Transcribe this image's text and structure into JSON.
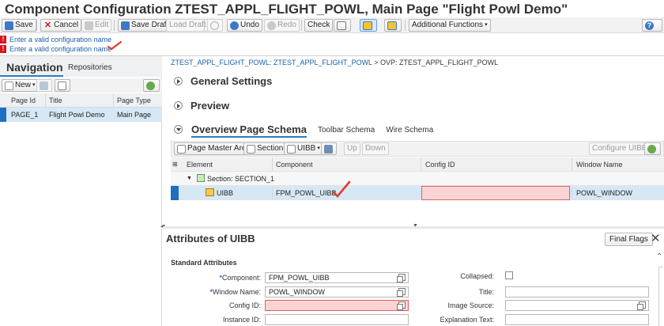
{
  "window": {
    "title": "Component Configuration ZTEST_APPL_FLIGHT_POWL, Main Page \"Flight Powl Demo\""
  },
  "toolbar": {
    "save": "Save",
    "cancel": "Cancel",
    "edit": "Edit",
    "save_draft": "Save Draft",
    "load_draft": "Load Draft",
    "undo": "Undo",
    "redo": "Redo",
    "check": "Check",
    "additional_functions": "Additional Functions"
  },
  "messages": [
    "Enter a valid configuration name",
    "Enter a valid configuration name"
  ],
  "navigation": {
    "title": "Navigation",
    "repositories_tab": "Repositories",
    "new_label": "New",
    "columns": [
      "Page Id",
      "Title",
      "Page Type"
    ],
    "rows": [
      {
        "page_id": "PAGE_1",
        "title": "Flight Powl Demo",
        "page_type": "Main Page"
      }
    ]
  },
  "breadcrumb": {
    "link": "ZTEST_APPL_FLIGHT_POWL: ZTEST_APPL_FLIGHT_POWL",
    "separator": ">",
    "current": "OVP: ZTEST_APPL_FLIGHT_POWL"
  },
  "sections": {
    "general": "General Settings",
    "preview": "Preview"
  },
  "ovp_tabs": {
    "active": "Overview Page Schema",
    "toolbar_schema": "Toolbar Schema",
    "wire_schema": "Wire Schema"
  },
  "schema_toolbar": {
    "page_master_area": "Page Master Area",
    "section": "Section",
    "uibb": "UIBB",
    "up": "Up",
    "down": "Down",
    "configure_uibb": "Configure UIBB"
  },
  "schema_grid": {
    "columns": [
      "Element",
      "Component",
      "Config ID",
      "Window Name"
    ],
    "section_row": "Section: SECTION_1",
    "uibb_row": {
      "element": "UIBB",
      "component": "FPM_POWL_UIBB",
      "config_id": "",
      "window_name": "POWL_WINDOW"
    }
  },
  "attributes": {
    "title": "Attributes of UIBB",
    "final_flags": "Final Flags",
    "close": "✕",
    "standard_title": "Standard Attributes",
    "component_label": "Component:",
    "component_value": "FPM_POWL_UIBB",
    "window_label": "Window Name:",
    "window_value": "POWL_WINDOW",
    "config_label": "Config ID:",
    "config_value": "",
    "instance_label": "Instance ID:",
    "instance_value": "",
    "collapsed_label": "Collapsed:",
    "title_label": "Title:",
    "title_value": "",
    "image_label": "Image Source:",
    "image_value": "",
    "explanation_label": "Explanation Text:",
    "explanation_value": ""
  },
  "colors": {
    "accent": "#2b7ac4",
    "selection": "#d6e8f5",
    "error_fill": "#fad4d4",
    "error_border": "#e06060",
    "annotation_check": "#e03a2e"
  }
}
